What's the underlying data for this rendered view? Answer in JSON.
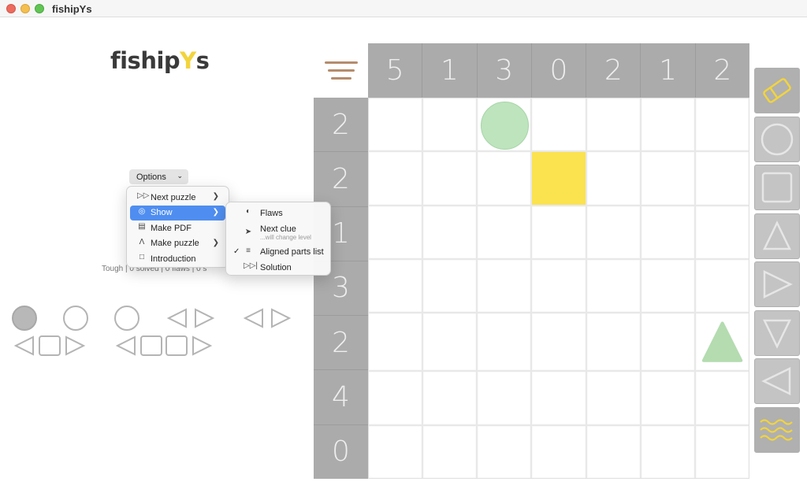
{
  "window": {
    "title": "fishipYs"
  },
  "logo": {
    "part1": "fiship",
    "part2": "Y",
    "part3": "s"
  },
  "options": {
    "label": "Options"
  },
  "status": {
    "text": "Tough | 0 solved | 0 flaws | 0 s"
  },
  "menu": {
    "items": [
      {
        "label": "Next puzzle",
        "icon": "fast-forward-icon",
        "submenu": true
      },
      {
        "label": "Show",
        "icon": "eye-icon",
        "submenu": true,
        "active": true
      },
      {
        "label": "Make PDF",
        "icon": "document-icon",
        "submenu": false
      },
      {
        "label": "Make puzzle",
        "icon": "compass-icon",
        "submenu": true
      },
      {
        "label": "Introduction",
        "icon": "speech-bubble-icon",
        "submenu": false
      }
    ]
  },
  "submenu": {
    "items": [
      {
        "label": "Flaws",
        "icon": "gauge-icon",
        "checked": false
      },
      {
        "label": "Next clue",
        "sublabel": "...will change level",
        "icon": "fish-icon",
        "checked": false
      },
      {
        "label": "Aligned parts list",
        "icon": "lines-icon",
        "checked": true
      },
      {
        "label": "Solution",
        "icon": "skip-forward-icon",
        "checked": false
      }
    ]
  },
  "board": {
    "col_clues": [
      "5",
      "1",
      "3",
      "0",
      "2",
      "1",
      "2"
    ],
    "row_clues": [
      "2",
      "2",
      "1",
      "3",
      "2",
      "4",
      "0"
    ],
    "pieces": [
      {
        "row": 0,
        "col": 2,
        "shape": "circle",
        "color": "#bde4bd"
      },
      {
        "row": 1,
        "col": 3,
        "shape": "square",
        "color": "#fbe24f"
      },
      {
        "row": 4,
        "col": 6,
        "shape": "triangle-up",
        "color": "#b4dcb0"
      }
    ]
  },
  "palette": {
    "tools": [
      "eraser-icon",
      "circle-icon",
      "square-icon",
      "triangle-up-icon",
      "triangle-right-icon",
      "triangle-down-icon",
      "triangle-left-icon",
      "waves-icon"
    ],
    "colors": {
      "tool_outline": "#e6e6e6",
      "eraser": "#f2d43c",
      "waves": "#f2d43c"
    }
  },
  "colors": {
    "clue_bg": "#ababab",
    "clue_text": "#eeeeee",
    "highlight": "#4f8ef0"
  }
}
